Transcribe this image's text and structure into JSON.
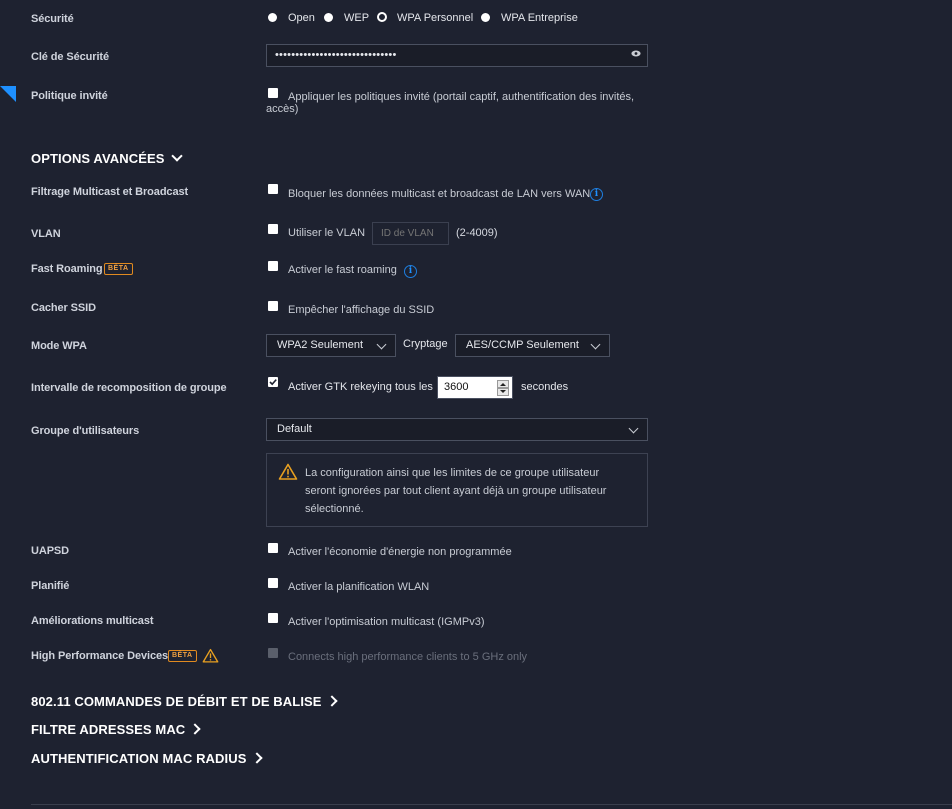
{
  "security": {
    "label": "Sécurité",
    "options": [
      "Open",
      "WEP",
      "WPA Personnel",
      "WPA Entreprise"
    ],
    "selected": "WPA Personnel"
  },
  "security_key": {
    "label": "Clé de Sécurité",
    "value": "••••••••••••••••••••••••••••••"
  },
  "guest_policy": {
    "label": "Politique invité",
    "checkbox_text_line1": "Appliquer les politiques invité (portail captif, authentification des invités,",
    "checkbox_text_line2": "accès)"
  },
  "advanced": {
    "title": "OPTIONS AVANCÉES",
    "multicast_filter": {
      "label": "Filtrage Multicast et Broadcast",
      "text": "Bloquer les données multicast et broadcast de LAN vers WAN"
    },
    "vlan": {
      "label": "VLAN",
      "text": "Utiliser le VLAN",
      "placeholder": "ID de VLAN",
      "range": "(2-4009)"
    },
    "fast_roaming": {
      "label": "Fast Roaming",
      "badge": "BÊTA",
      "text": "Activer le fast roaming"
    },
    "hide_ssid": {
      "label": "Cacher SSID",
      "text": "Empêcher l'affichage du SSID"
    },
    "wpa_mode": {
      "label": "Mode WPA",
      "value": "WPA2 Seulement",
      "encryption_label": "Cryptage",
      "encryption_value": "AES/CCMP Seulement"
    },
    "group_rekey": {
      "label": "Intervalle de recomposition de groupe",
      "text": "Activer GTK rekeying tous les",
      "value": "3600",
      "unit": "secondes",
      "checked": true
    },
    "user_group": {
      "label": "Groupe d'utilisateurs",
      "value": "Default",
      "warning_line1": "La configuration ainsi que les limites de ce groupe utilisateur",
      "warning_line2": "seront ignorées par tout client ayant déjà un groupe utilisateur",
      "warning_line3": "sélectionné."
    },
    "uapsd": {
      "label": "UAPSD",
      "text": "Activer l'économie d'énergie non programmée"
    },
    "scheduled": {
      "label": "Planifié",
      "text": "Activer la planification WLAN"
    },
    "multicast_enh": {
      "label": "Améliorations multicast",
      "text": "Activer l'optimisation multicast (IGMPv3)"
    },
    "hpd": {
      "label": "High Performance Devices",
      "badge": "BÊTA",
      "text": "Connects high performance clients to 5 GHz only"
    }
  },
  "sections": {
    "rates": "802.11 COMMANDES DE DÉBIT ET DE BALISE",
    "mac_filter": "FILTRE ADRESSES MAC",
    "radius_mac": "AUTHENTIFICATION MAC RADIUS"
  },
  "colors": {
    "background": "#1e2230",
    "accent": "#1e90ff",
    "beta": "#e08a20"
  }
}
